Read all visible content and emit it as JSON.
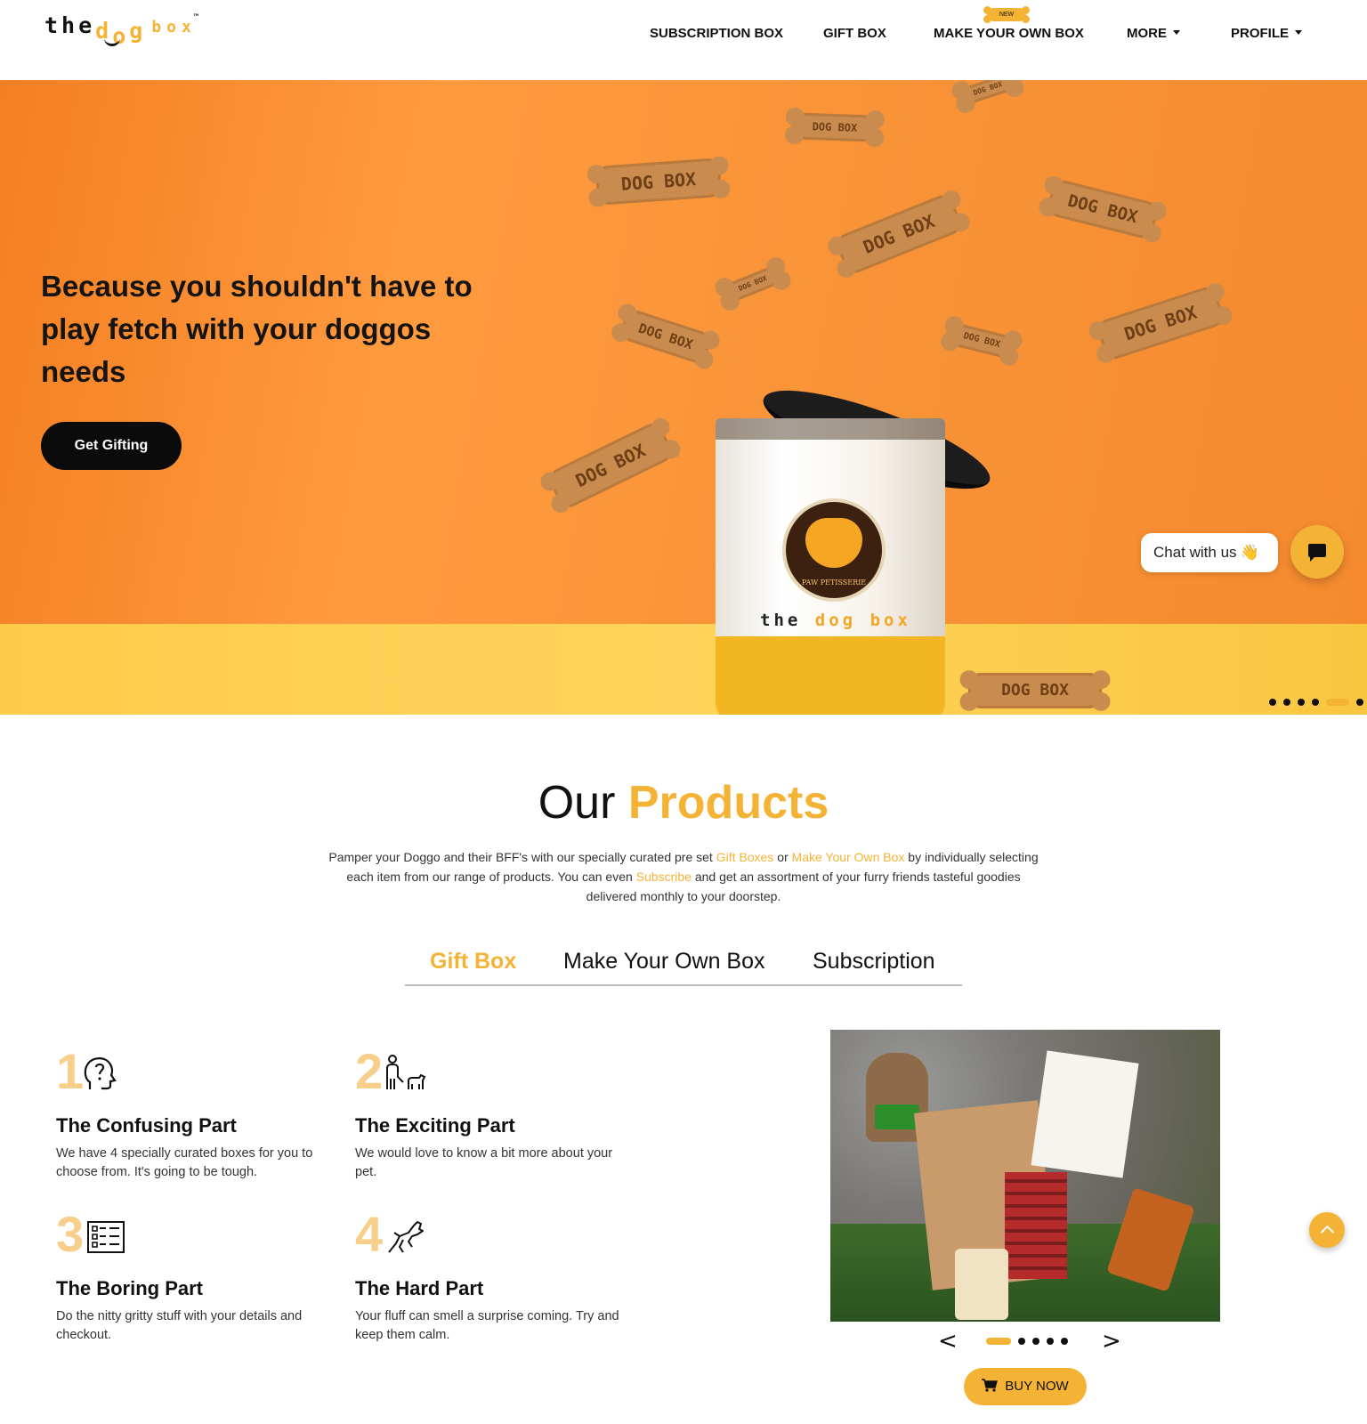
{
  "brand": {
    "the": "the",
    "dog": [
      "d",
      "o",
      "g"
    ],
    "box": "box",
    "tm": "™"
  },
  "nav": {
    "items": [
      {
        "label": "SUBSCRIPTION BOX"
      },
      {
        "label": "GIFT BOX"
      },
      {
        "label": "MAKE YOUR OWN BOX",
        "badge": "NEW"
      },
      {
        "label": "MORE",
        "dropdown": true
      },
      {
        "label": "PROFILE",
        "dropdown": true
      }
    ]
  },
  "hero": {
    "title": "Because you shouldn't have to play fetch with your doggos needs",
    "cta": "Get Gifting",
    "biscuit_text": "DOG BOX",
    "jar_badge_text": "PAW PETISSERIE",
    "jar_logo": {
      "the": "the",
      "dog": "dog",
      "box": "box"
    },
    "slides_count": 6,
    "active_slide": 5
  },
  "chat": {
    "label": "Chat with us",
    "wave": "👋",
    "icon": "chat-bubble-icon"
  },
  "products": {
    "title_light": "Our",
    "title_accent": "Products",
    "desc": {
      "p1": "Pamper your Doggo and their BFF's with our specially curated pre set ",
      "link1": "Gift Boxes",
      "p2": " or ",
      "link2": "Make Your Own Box",
      "p3": " by individually selecting each item from our range of products. You can even ",
      "link3": "Subscribe",
      "p4": " and get an assortment of your furry friends tasteful goodies delivered monthly to your doorstep."
    },
    "tabs": [
      {
        "label": "Gift Box",
        "active": true
      },
      {
        "label": "Make Your Own Box",
        "active": false
      },
      {
        "label": "Subscription",
        "active": false
      }
    ],
    "steps": [
      {
        "num": "1",
        "icon": "head-question-icon",
        "title": "The Confusing Part",
        "text": "We have 4 specially curated boxes for you to choose from. It's going to be tough."
      },
      {
        "num": "2",
        "icon": "person-with-dog-icon",
        "title": "The Exciting Part",
        "text": "We would love to know a bit more about your pet."
      },
      {
        "num": "3",
        "icon": "checklist-form-icon",
        "title": "The Boring Part",
        "text": "Do the nitty gritty stuff with your details and checkout."
      },
      {
        "num": "4",
        "icon": "jumping-dog-icon",
        "title": "The Hard Part",
        "text": "Your fluff can smell a surprise coming. Try and keep them calm."
      }
    ],
    "carousel": {
      "prev": "<",
      "next": ">",
      "dots": 5,
      "active": 0
    },
    "buy_now": "BUY NOW"
  },
  "colors": {
    "accent": "#f5b335",
    "hero_orange": "#f99338",
    "dark": "#111111"
  }
}
